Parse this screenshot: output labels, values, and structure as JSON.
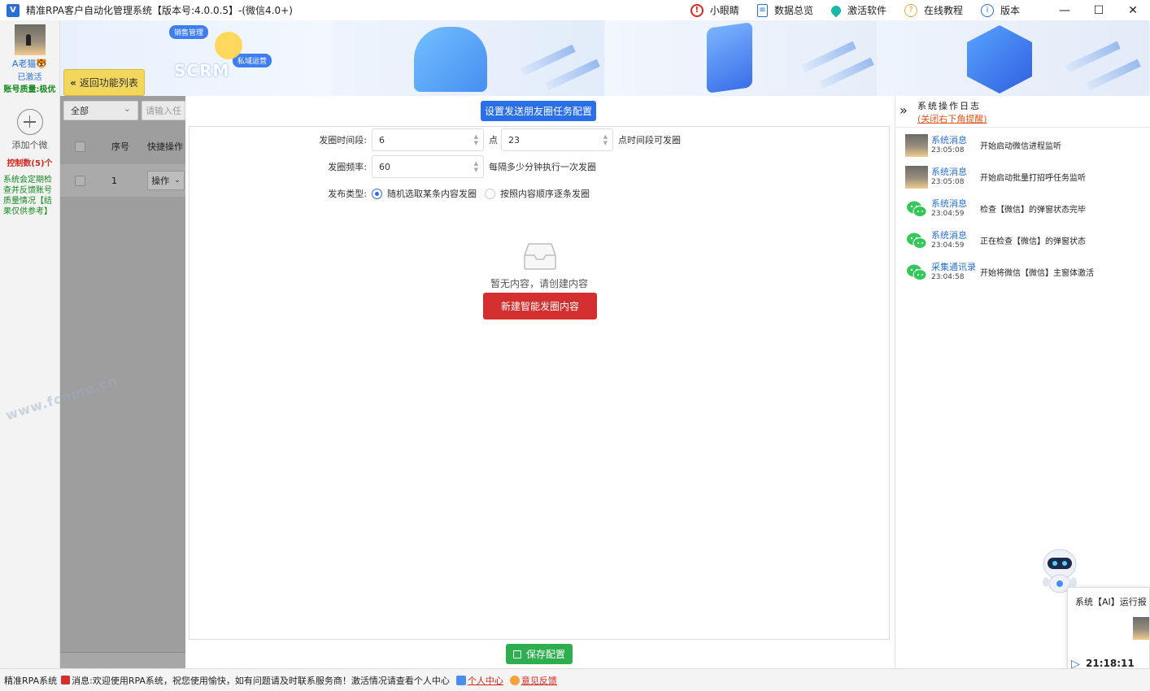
{
  "window": {
    "title": "精准RPA客户自动化管理系统【版本号:4.0.0.5】-(微信4.0+)",
    "logo_text": "V"
  },
  "toolbar": {
    "items": [
      {
        "label": "小眼睛",
        "icon": "eye-icon"
      },
      {
        "label": "数据总览",
        "icon": "document-icon"
      },
      {
        "label": "激活软件",
        "icon": "pin-icon"
      },
      {
        "label": "在线教程",
        "icon": "help-icon"
      },
      {
        "label": "版本",
        "icon": "info-icon"
      }
    ]
  },
  "sidebar": {
    "account_name": "A老猫🐯",
    "status": "已激活",
    "quality": "账号质量:极优",
    "add_label": "添加个微",
    "control_count": "控制数(5)个",
    "notice": "系统会定期检查并反馈账号质量情况【结果仅供参考】"
  },
  "banner": {
    "back_label": "返回功能列表",
    "scrm": "SCRM",
    "chips": [
      "销售管理",
      "私域运营"
    ]
  },
  "list": {
    "filter_value": "全部",
    "search_placeholder": "请输入任",
    "columns": [
      "序号",
      "快捷操作"
    ],
    "rows": [
      {
        "index": "1",
        "action": "操作"
      }
    ]
  },
  "main": {
    "config_button": "设置发送朋友圈任务配置",
    "time_label": "发圈时间段:",
    "time_start": "6",
    "time_mid": "点",
    "time_end": "23",
    "time_suffix": "点时间段可发圈",
    "freq_label": "发圈频率:",
    "freq_value": "60",
    "freq_suffix": "每隔多少分钟执行一次发圈",
    "type_label": "发布类型:",
    "type_options": [
      "随机选取某条内容发圈",
      "按照内容顺序逐条发圈"
    ],
    "type_selected": 0,
    "empty_text": "暂无内容，请创建内容",
    "create_button": "新建智能发圈内容",
    "save_button": "保存配置"
  },
  "log": {
    "title": "系统操作日志",
    "close_hint": "(关闭右下角提醒)",
    "items": [
      {
        "source": "系统消息",
        "time": "23:05:08",
        "message": "开始启动微信进程监听",
        "avatar": "photo"
      },
      {
        "source": "系统消息",
        "time": "23:05:08",
        "message": "开始启动批量打招呼任务监听",
        "avatar": "photo"
      },
      {
        "source": "系统消息",
        "time": "23:04:59",
        "message": "检查【微信】的弹窗状态完毕",
        "avatar": "wechat"
      },
      {
        "source": "系统消息",
        "time": "23:04:59",
        "message": "正在检查【微信】的弹窗状态",
        "avatar": "wechat"
      },
      {
        "source": "采集通讯录",
        "time": "23:04:58",
        "message": "开始将微信【微信】主窗体激活",
        "avatar": "wechat"
      }
    ]
  },
  "popup": {
    "title": "系统【AI】运行报",
    "time": "21:18:11"
  },
  "statusbar": {
    "app": "精准RPA系统",
    "message": "消息:欢迎使用RPA系统，祝您使用愉快，如有问题请及时联系服务商！激活情况请查看个人中心",
    "personal_center": "个人中心",
    "feedback": "意见反馈"
  },
  "watermark": "www.fcnme.cn",
  "colors": {
    "primary": "#2a6fe8",
    "danger": "#d32f2f",
    "success": "#2fae4f",
    "warning": "#f3d75c"
  }
}
